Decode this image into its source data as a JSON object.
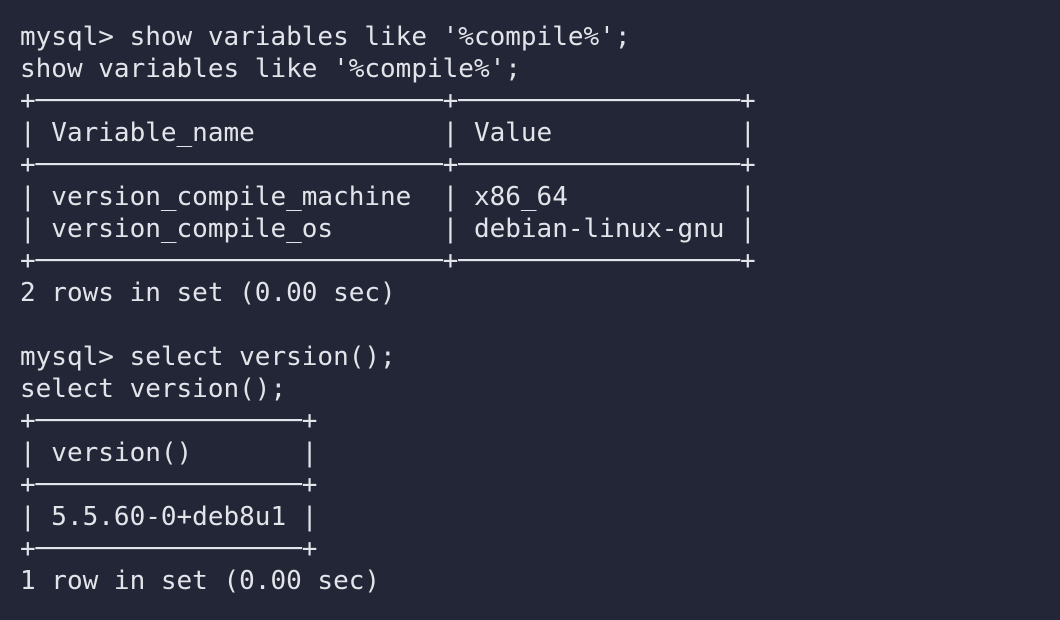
{
  "terminal": {
    "lines": [
      "mysql> show variables like '%compile%';",
      "show variables like '%compile%';",
      "+──────────────────────────+──────────────────+",
      "| Variable_name            | Value            |",
      "+──────────────────────────+──────────────────+",
      "| version_compile_machine  | x86_64           |",
      "| version_compile_os       | debian-linux-gnu |",
      "+──────────────────────────+──────────────────+",
      "2 rows in set (0.00 sec)",
      "",
      "mysql> select version();",
      "select version();",
      "+─────────────────+",
      "| version()       |",
      "+─────────────────+",
      "| 5.5.60-0+deb8u1 |",
      "+─────────────────+",
      "1 row in set (0.00 sec)"
    ]
  }
}
